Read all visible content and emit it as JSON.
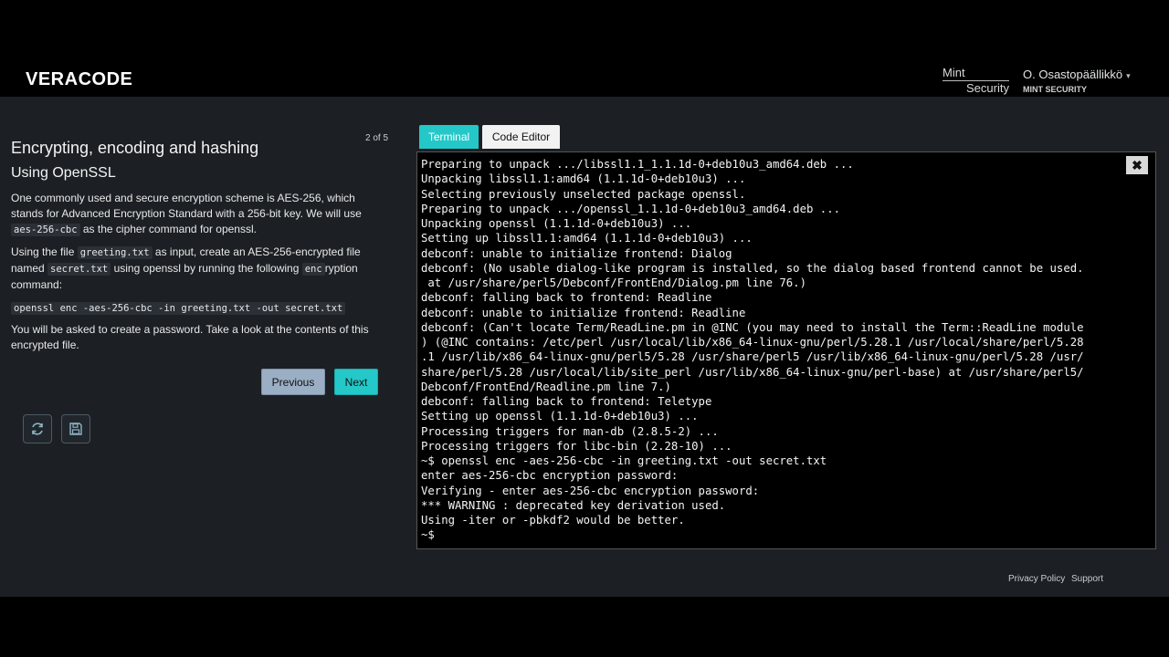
{
  "brand": {
    "logo": "VERACODE",
    "org_logo_line1": "Mint",
    "org_logo_line2": "Security"
  },
  "user": {
    "name": "O. Osastopäällikkö",
    "org": "MINT SECURITY"
  },
  "lesson": {
    "step": "2 of 5",
    "title": "Encrypting, encoding and hashing",
    "subtitle": "Using OpenSSL",
    "p1_a": "One commonly used and secure encryption scheme is AES-256, which stands for Advanced Encryption Standard with a 256-bit key. We will use ",
    "p1_code": "aes-256-cbc",
    "p1_b": " as the cipher command for openssl.",
    "p2_a": "Using the file ",
    "p2_code1": "greeting.txt",
    "p2_b": " as input, create an AES-256-encrypted file named ",
    "p2_code2": "secret.txt",
    "p2_c": " using openssl by running the following ",
    "p2_code3": "enc",
    "p2_d": "ryption command:",
    "command": "openssl enc -aes-256-cbc -in greeting.txt -out secret.txt",
    "p3": "You will be asked to create a password. Take a look at the contents of this encrypted file.",
    "prev_label": "Previous",
    "next_label": "Next"
  },
  "tools": {
    "refresh_icon": "refresh-icon",
    "save_icon": "save-icon"
  },
  "tabs": {
    "terminal": "Terminal",
    "editor": "Code Editor"
  },
  "terminal": {
    "close_icon": "close-icon",
    "lines": [
      "Preparing to unpack .../libssl1.1_1.1.1d-0+deb10u3_amd64.deb ...",
      "Unpacking libssl1.1:amd64 (1.1.1d-0+deb10u3) ...",
      "Selecting previously unselected package openssl.",
      "Preparing to unpack .../openssl_1.1.1d-0+deb10u3_amd64.deb ...",
      "Unpacking openssl (1.1.1d-0+deb10u3) ...",
      "Setting up libssl1.1:amd64 (1.1.1d-0+deb10u3) ...",
      "debconf: unable to initialize frontend: Dialog",
      "debconf: (No usable dialog-like program is installed, so the dialog based frontend cannot be used.",
      " at /usr/share/perl5/Debconf/FrontEnd/Dialog.pm line 76.)",
      "debconf: falling back to frontend: Readline",
      "debconf: unable to initialize frontend: Readline",
      "debconf: (Can't locate Term/ReadLine.pm in @INC (you may need to install the Term::ReadLine module",
      ") (@INC contains: /etc/perl /usr/local/lib/x86_64-linux-gnu/perl/5.28.1 /usr/local/share/perl/5.28",
      ".1 /usr/lib/x86_64-linux-gnu/perl5/5.28 /usr/share/perl5 /usr/lib/x86_64-linux-gnu/perl/5.28 /usr/",
      "share/perl/5.28 /usr/local/lib/site_perl /usr/lib/x86_64-linux-gnu/perl-base) at /usr/share/perl5/",
      "Debconf/FrontEnd/Readline.pm line 7.)",
      "debconf: falling back to frontend: Teletype",
      "Setting up openssl (1.1.1d-0+deb10u3) ...",
      "Processing triggers for man-db (2.8.5-2) ...",
      "Processing triggers for libc-bin (2.28-10) ...",
      "~$ openssl enc -aes-256-cbc -in greeting.txt -out secret.txt",
      "enter aes-256-cbc encryption password:",
      "Verifying - enter aes-256-cbc encryption password:",
      "*** WARNING : deprecated key derivation used.",
      "Using -iter or -pbkdf2 would be better.",
      "~$"
    ]
  },
  "footer": {
    "privacy": "Privacy Policy",
    "support": "Support"
  }
}
